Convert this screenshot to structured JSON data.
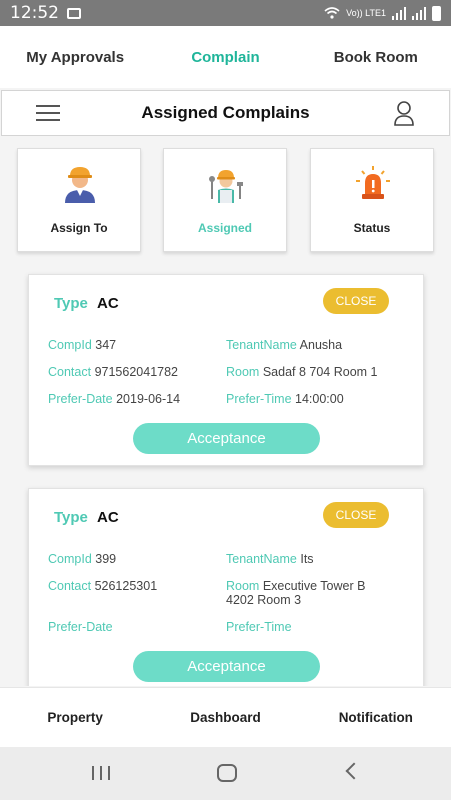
{
  "status_bar": {
    "time": "12:52",
    "network": "Vo)) LTE1"
  },
  "top_tabs": [
    {
      "label": "My Approvals",
      "active": false
    },
    {
      "label": "Complain",
      "active": true
    },
    {
      "label": "Book Room",
      "active": false
    }
  ],
  "header": {
    "title": "Assigned Complains"
  },
  "categories": [
    {
      "label": "Assign To",
      "icon": "worker-icon",
      "active": false
    },
    {
      "label": "Assigned",
      "icon": "worker-tools-icon",
      "active": true
    },
    {
      "label": "Status",
      "icon": "siren-icon",
      "active": false
    }
  ],
  "labels": {
    "type": "Type",
    "comp_id": "CompId",
    "tenant_name": "TenantName",
    "contact": "Contact",
    "room": "Room",
    "prefer_date": "Prefer-Date",
    "prefer_time": "Prefer-Time",
    "close": "CLOSE",
    "acceptance": "Acceptance"
  },
  "complaints": [
    {
      "type": "AC",
      "comp_id": "347",
      "tenant_name": "Anusha",
      "contact": "971562041782",
      "room_line1": "Sadaf 8 704 Room 1",
      "room_line2": "",
      "prefer_date": "2019-06-14",
      "prefer_time": "14:00:00"
    },
    {
      "type": "AC",
      "comp_id": "399",
      "tenant_name": "Its",
      "contact": "526125301",
      "room_line1": "Executive Tower B",
      "room_line2": "4202 Room 3",
      "prefer_date": "",
      "prefer_time": ""
    }
  ],
  "bottom_nav": [
    {
      "label": "Property"
    },
    {
      "label": "Dashboard"
    },
    {
      "label": "Notification"
    }
  ],
  "colors": {
    "accent": "#1fb59a",
    "teal": "#4fc9b4",
    "close_badge": "#ebbd30",
    "accept_button": "#6ddcc8"
  }
}
